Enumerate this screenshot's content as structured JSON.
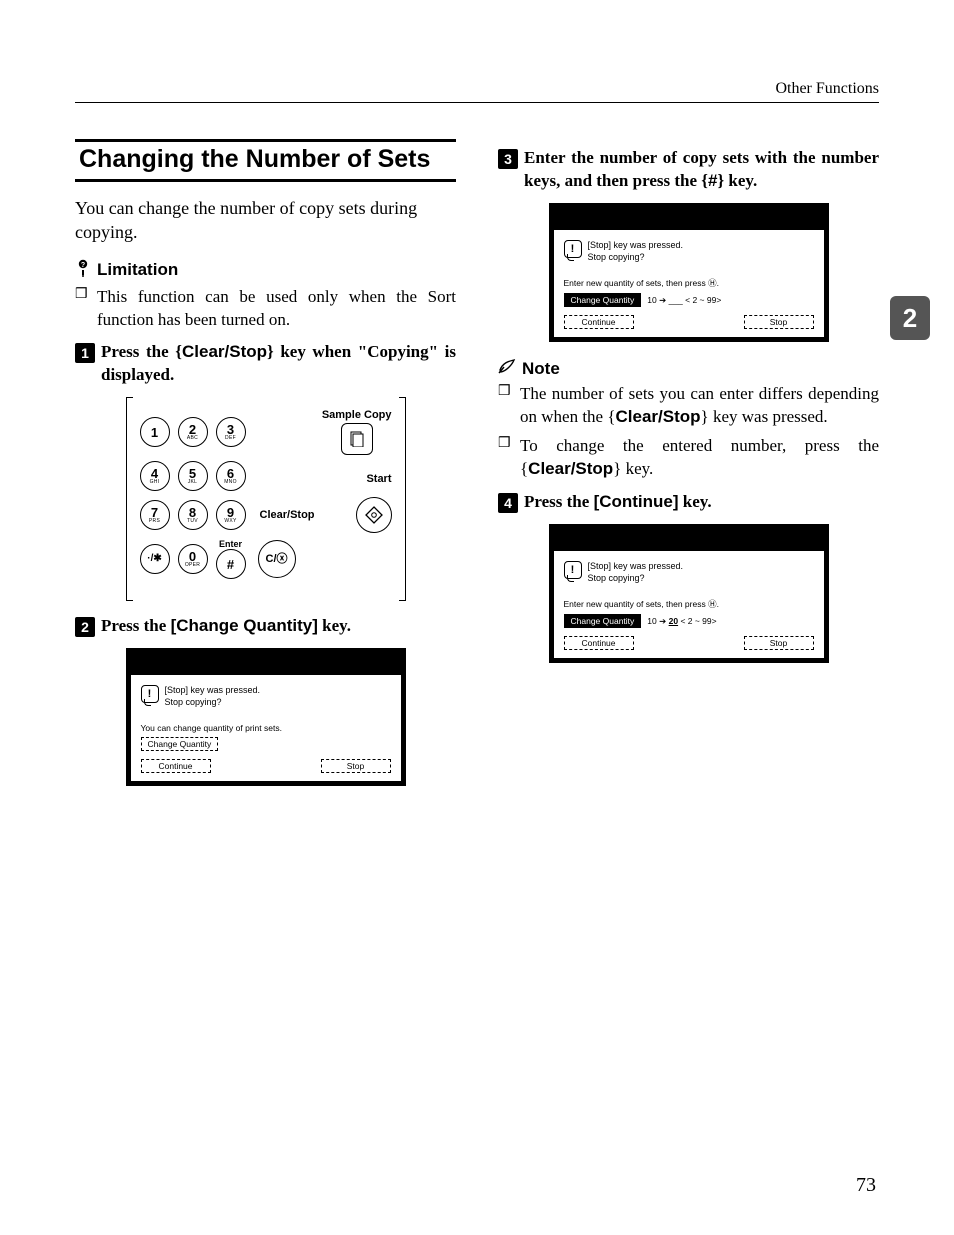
{
  "header": {
    "section_name": "Other Functions"
  },
  "chapter_tab": "2",
  "page_number": "73",
  "title": "Changing the Number of Sets",
  "intro": "You can change the number of copy sets during copying.",
  "limitation": {
    "heading": "Limitation",
    "items": [
      "This function can be used only when the Sort function has been turned on."
    ]
  },
  "note": {
    "heading": "Note",
    "items": [
      "The number of sets you can enter differs depending on when the {Clear/Stop} key was pressed.",
      "To change the entered number, press the {Clear/Stop} key."
    ]
  },
  "steps": {
    "s1": {
      "num": "1",
      "pre": "Press the ",
      "key": "Clear/Stop",
      "post": " key when \"Copying\" is displayed."
    },
    "s2": {
      "num": "2",
      "pre": "Press the ",
      "btn": "[Change Quantity]",
      "post": " key."
    },
    "s3": {
      "num": "3",
      "text": "Enter the number of copy sets with the number keys, and then press the ",
      "key": "#",
      "post": " key."
    },
    "s4": {
      "num": "4",
      "pre": "Press the ",
      "btn": "[Continue]",
      "post": " key."
    }
  },
  "keypad": {
    "keys": [
      {
        "main": "1",
        "sub": ""
      },
      {
        "main": "2",
        "sub": "ABC"
      },
      {
        "main": "3",
        "sub": "DEF"
      },
      {
        "main": "4",
        "sub": "GHI"
      },
      {
        "main": "5",
        "sub": "JKL"
      },
      {
        "main": "6",
        "sub": "MNO"
      },
      {
        "main": "7",
        "sub": "PRS"
      },
      {
        "main": "8",
        "sub": "TUV"
      },
      {
        "main": "9",
        "sub": "WXY"
      },
      {
        "main": "·/✱",
        "sub": ""
      },
      {
        "main": "0",
        "sub": "OPER"
      },
      {
        "main": "#",
        "sub": ""
      }
    ],
    "sample_copy": "Sample Copy",
    "start": "Start",
    "clear_stop": "Clear/Stop",
    "enter": "Enter",
    "c_key": "C/ⓧ"
  },
  "lcd_common": {
    "line1": "[Stop] key was pressed.",
    "line2": "Stop copying?",
    "continue": "Continue",
    "stop": "Stop",
    "change_qty": "Change Quantity"
  },
  "lcd2": {
    "subtext": "You can change quantity of print sets."
  },
  "lcd3": {
    "subtext": "Enter new quantity of sets, then press Ⓗ.",
    "qty": "10 ➔ ___   <   2 ~  99>"
  },
  "lcd4": {
    "subtext": "Enter new quantity of sets, then press Ⓗ.",
    "qty_pre": "10 ➔ ",
    "qty_val": "20",
    "qty_post": "   <   2 ~  99>"
  }
}
